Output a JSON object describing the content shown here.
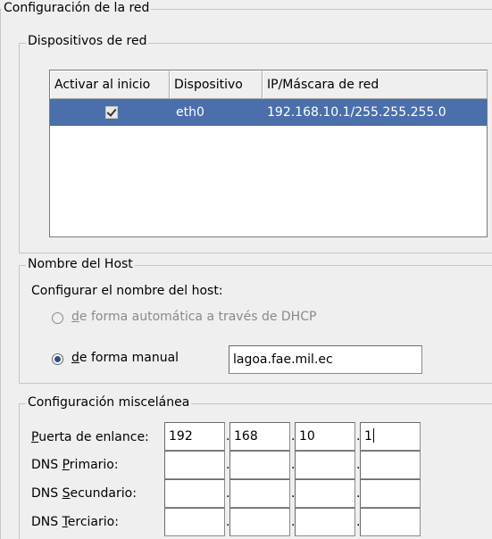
{
  "window": {
    "title": "Configuración de la red"
  },
  "devices": {
    "title": "Dispositivos de red",
    "columns": [
      "Activar al inicio",
      "Dispositivo",
      "IP/Máscara de red"
    ],
    "rows": [
      {
        "active": true,
        "device": "eth0",
        "ip_mask": "192.168.10.1/255.255.255.0"
      }
    ]
  },
  "hostname": {
    "title": "Nombre del Host",
    "configure_label": "Configurar el nombre del host:",
    "auto_option": {
      "mnemonic": "d",
      "rest": "e forma automática a través de DHCP",
      "selected": false,
      "enabled": false
    },
    "manual_option": {
      "mnemonic": "d",
      "rest": "e forma manual",
      "selected": true
    },
    "manual_value": "lagoa.fae.mil.ec"
  },
  "misc": {
    "title": "Configuración miscelánea",
    "gateway": {
      "mnemonic": "P",
      "rest": "uerta de enlance:",
      "octets": [
        "192",
        "168",
        "10",
        "1"
      ]
    },
    "dns1": {
      "prefix": "DNS ",
      "mnemonic": "P",
      "rest": "rimario:",
      "octets": [
        "",
        "",
        "",
        ""
      ]
    },
    "dns2": {
      "prefix": "DNS ",
      "mnemonic": "S",
      "rest": "ecundario:",
      "octets": [
        "",
        "",
        "",
        ""
      ]
    },
    "dns3": {
      "prefix": "DNS ",
      "mnemonic": "T",
      "rest": "erciario:",
      "octets": [
        "",
        "",
        "",
        ""
      ]
    },
    "separator": "."
  }
}
